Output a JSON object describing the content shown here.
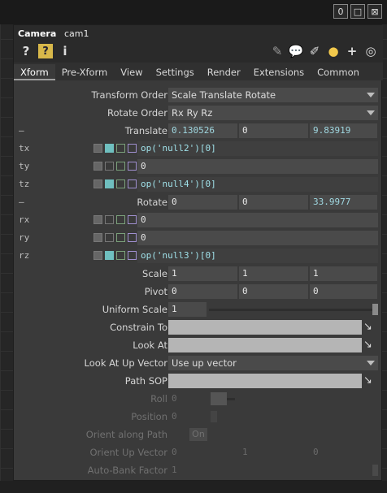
{
  "window": {
    "buttons": [
      "0",
      "□",
      "⊠"
    ]
  },
  "header": {
    "op_type": "Camera",
    "op_name": "cam1"
  },
  "toolbar": {
    "left_icons": [
      "help-icon",
      "python-help-icon",
      "info-icon"
    ],
    "right_icons": [
      "pencil-icon",
      "comment-icon",
      "note-icon",
      "python-icon",
      "add-icon",
      "target-icon"
    ]
  },
  "tabs": [
    "Xform",
    "Pre-Xform",
    "View",
    "Settings",
    "Render",
    "Extensions",
    "Common"
  ],
  "params": {
    "transform_order": {
      "label": "Transform Order",
      "value": "Scale Translate Rotate"
    },
    "rotate_order": {
      "label": "Rotate Order",
      "value": "Rx Ry Rz"
    },
    "translate": {
      "label": "Translate",
      "values": [
        "0.130526",
        "0",
        "9.83919"
      ]
    },
    "tx": {
      "label": "tx",
      "value": "op('null2')[0]"
    },
    "ty": {
      "label": "ty",
      "value": "0"
    },
    "tz": {
      "label": "tz",
      "value": "op('null4')[0]"
    },
    "rotate": {
      "label": "Rotate",
      "values": [
        "0",
        "0",
        "33.9977"
      ]
    },
    "rx": {
      "label": "rx",
      "value": "0"
    },
    "ry": {
      "label": "ry",
      "value": "0"
    },
    "rz": {
      "label": "rz",
      "value": "op('null3')[0]"
    },
    "scale": {
      "label": "Scale",
      "values": [
        "1",
        "1",
        "1"
      ]
    },
    "pivot": {
      "label": "Pivot",
      "values": [
        "0",
        "0",
        "0"
      ]
    },
    "uniform_scale": {
      "label": "Uniform Scale",
      "value": "1"
    },
    "constrain_to": {
      "label": "Constrain To"
    },
    "look_at": {
      "label": "Look At"
    },
    "look_at_up": {
      "label": "Look At Up Vector",
      "value": "Use up vector"
    },
    "path_sop": {
      "label": "Path SOP"
    },
    "roll": {
      "label": "Roll",
      "value": "0"
    },
    "position": {
      "label": "Position",
      "value": "0"
    },
    "orient_along_path": {
      "label": "Orient along Path",
      "value": "On"
    },
    "orient_up_vector": {
      "label": "Orient Up Vector",
      "values": [
        "0",
        "1",
        "0"
      ]
    },
    "auto_bank": {
      "label": "Auto-Bank Factor",
      "value": "1"
    }
  },
  "expand_marker": "—"
}
